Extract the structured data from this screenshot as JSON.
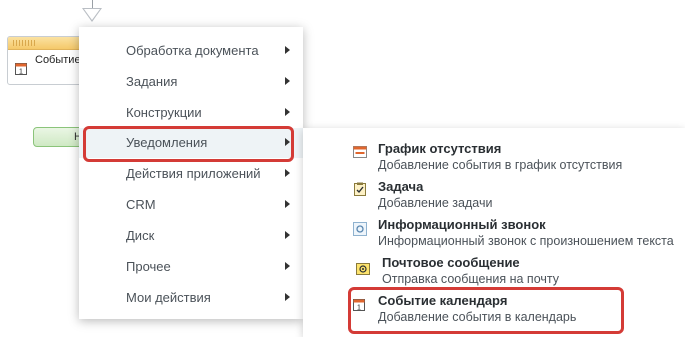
{
  "workflow_block": {
    "title": "Событие",
    "icon": "calendar-icon"
  },
  "workflow_button": {
    "label": "Н"
  },
  "menu": {
    "items": [
      {
        "label": "Обработка документа",
        "has_submenu": true
      },
      {
        "label": "Задания",
        "has_submenu": true
      },
      {
        "label": "Конструкции",
        "has_submenu": true
      },
      {
        "label": "Уведомления",
        "has_submenu": true,
        "active": true
      },
      {
        "label": "Действия приложений",
        "has_submenu": true
      },
      {
        "label": "CRM",
        "has_submenu": true
      },
      {
        "label": "Диск",
        "has_submenu": true
      },
      {
        "label": "Прочее",
        "has_submenu": true
      },
      {
        "label": "Мои действия",
        "has_submenu": true
      }
    ]
  },
  "submenu": {
    "items": [
      {
        "title": "График отсутствия",
        "description": "Добавление события в график отсутствия",
        "icon": "absence-chart-icon"
      },
      {
        "title": "Задача",
        "description": "Добавление задачи",
        "icon": "task-icon"
      },
      {
        "title": "Информационный звонок",
        "description": "Информационный звонок с произношением текста",
        "icon": "info-call-icon"
      },
      {
        "title": "Почтовое сообщение",
        "description": "Отправка сообщения на почту",
        "icon": "mail-icon"
      },
      {
        "title": "Событие календаря",
        "description": "Добавление события в календарь",
        "icon": "calendar-icon",
        "highlighted": true
      }
    ]
  },
  "colors": {
    "highlight": "#d43b36",
    "menu_text": "#4b5259",
    "block_header": "#f5c96a"
  }
}
